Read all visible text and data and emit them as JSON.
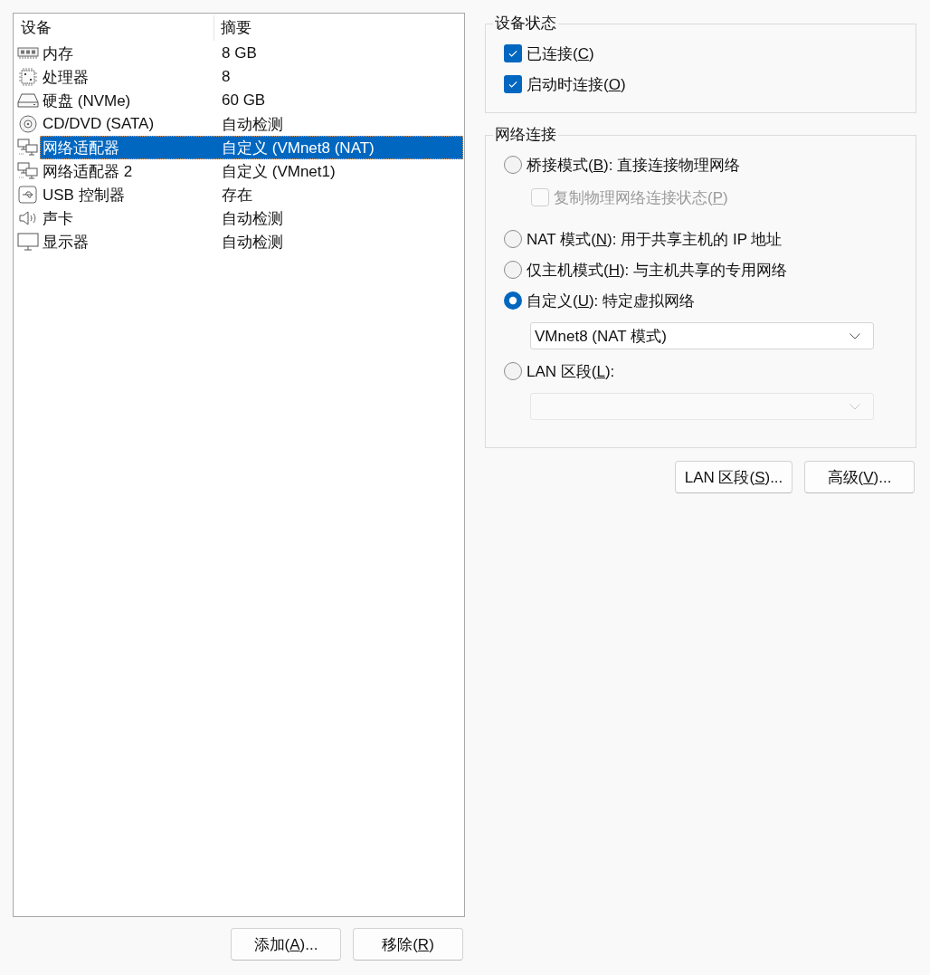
{
  "device_list": {
    "columns": [
      "设备",
      "摘要"
    ],
    "rows": [
      {
        "kind": "memory",
        "device": "内存",
        "summary": "8 GB",
        "selected": false
      },
      {
        "kind": "processor",
        "device": "处理器",
        "summary": "8",
        "selected": false
      },
      {
        "kind": "disk",
        "device": "硬盘 (NVMe)",
        "summary": "60 GB",
        "selected": false
      },
      {
        "kind": "cdrom",
        "device": "CD/DVD (SATA)",
        "summary": "自动检测",
        "selected": false
      },
      {
        "kind": "network",
        "device": "网络适配器",
        "summary": "自定义 (VMnet8 (NAT)",
        "selected": true
      },
      {
        "kind": "network",
        "device": "网络适配器 2",
        "summary": "自定义 (VMnet1)",
        "selected": false
      },
      {
        "kind": "usb",
        "device": "USB 控制器",
        "summary": "存在",
        "selected": false
      },
      {
        "kind": "sound",
        "device": "声卡",
        "summary": "自动检测",
        "selected": false
      },
      {
        "kind": "display",
        "device": "显示器",
        "summary": "自动检测",
        "selected": false
      }
    ]
  },
  "list_buttons": [
    {
      "label": "添加(",
      "access_key": "A",
      "label_end": ")..."
    },
    {
      "label": "移除(",
      "access_key": "R",
      "label_end": ")"
    }
  ],
  "device_status": {
    "title": "设备状态",
    "options": [
      {
        "label": "已连接(",
        "access_key": "C",
        "label_end": ")",
        "checked": true
      },
      {
        "label": "启动时连接(",
        "access_key": "O",
        "label_end": ")",
        "checked": true
      }
    ]
  },
  "network_connection": {
    "title": "网络连接",
    "options": [
      {
        "kind": "radio",
        "label": "桥接模式(",
        "access_key": "B",
        "label_end": "): 直接连接物理网络",
        "selected": false
      },
      {
        "kind": "checkbox",
        "label": "复制物理网络连接状态(",
        "access_key": "P",
        "label_end": ")",
        "checked": false,
        "disabled": true
      },
      {
        "kind": "radio",
        "label": "NAT 模式(",
        "access_key": "N",
        "label_end": "): 用于共享主机的 IP 地址",
        "selected": false
      },
      {
        "kind": "radio",
        "label": "仅主机模式(",
        "access_key": "H",
        "label_end": "): 与主机共享的专用网络",
        "selected": false
      },
      {
        "kind": "radio",
        "label": "自定义(",
        "access_key": "U",
        "label_end": "): 特定虚拟网络",
        "selected": true
      },
      {
        "kind": "dropdown",
        "value": "VMnet8 (NAT 模式)",
        "disabled": false
      },
      {
        "kind": "radio",
        "label": "LAN 区段(",
        "access_key": "L",
        "label_end": "):",
        "selected": false
      },
      {
        "kind": "dropdown",
        "disabled": true
      }
    ]
  },
  "network_buttons": [
    {
      "label": "LAN 区段(",
      "access_key": "S",
      "label_end": ")..."
    },
    {
      "label": "高级(",
      "access_key": "V",
      "label_end": ")..."
    }
  ]
}
